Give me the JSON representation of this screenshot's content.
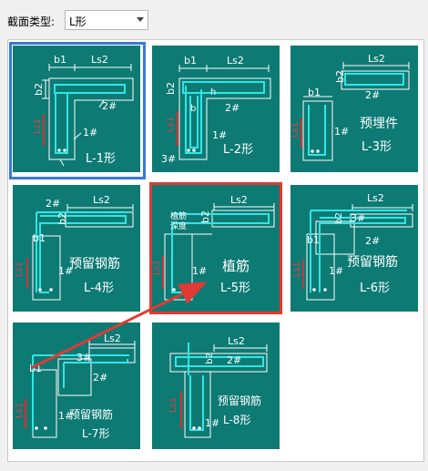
{
  "toolbar": {
    "section_type_label": "截面类型:",
    "section_type_value": "L形"
  },
  "colors": {
    "thumb_bg": "#0d7a74",
    "rebar": "#2ee6e6",
    "dim": "#ffffff",
    "sel_border": "#3a79d6",
    "highlight": "#e03a33"
  },
  "thumbs": [
    {
      "caption": "L-1形",
      "labels": {
        "b1": "b1",
        "ls2": "Ls2",
        "b2": "b2",
        "bar2": "2#",
        "bar1": "1#",
        "ls1": "Ls1"
      }
    },
    {
      "caption": "L-2形",
      "labels": {
        "b1": "b1",
        "ls2": "Ls2",
        "b2": "b2",
        "bar2": "2#",
        "bar1": "1#",
        "bar3": "3#",
        "ls1": "Ls1",
        "h": "h",
        "b": "b"
      }
    },
    {
      "caption": "L-3形",
      "title": "预埋件",
      "labels": {
        "ls2": "Ls2",
        "b2": "b2",
        "b1": "b1",
        "bar2": "2#",
        "bar1": "1#",
        "ls1": "Ls1"
      }
    },
    {
      "caption": "L-4形",
      "title": "预留钢筋",
      "labels": {
        "bar2": "2#",
        "ls2": "Ls2",
        "b2": "b2",
        "b1": "b1",
        "bar1": "1#",
        "ls1": "Ls1"
      }
    },
    {
      "caption": "L-5形",
      "title": "植筋",
      "labels": {
        "ls2": "Ls2",
        "plant_depth_1": "植筋",
        "plant_depth_2": "深度",
        "b2": "b2",
        "bar1": "1#",
        "ls1": "Ls1"
      }
    },
    {
      "caption": "L-6形",
      "title": "预留钢筋",
      "labels": {
        "ls2": "Ls2",
        "b2": "b2",
        "bar3": "3#",
        "b1": "b1",
        "bar2": "2#",
        "bar1": "1#",
        "ls1": "Ls1"
      }
    },
    {
      "caption": "L-7形",
      "title": "预留钢筋",
      "labels": {
        "ls2": "Ls2",
        "b1": "b1",
        "bar3": "3#",
        "bar2": "2#",
        "bar1": "1#",
        "ls1": "Ls1"
      }
    },
    {
      "caption": "L-8形",
      "title": "预留钢筋",
      "labels": {
        "ls2": "Ls2",
        "b2": "b2",
        "bar2": "2#",
        "bar1": "1#",
        "ls1": "Ls1"
      }
    }
  ]
}
